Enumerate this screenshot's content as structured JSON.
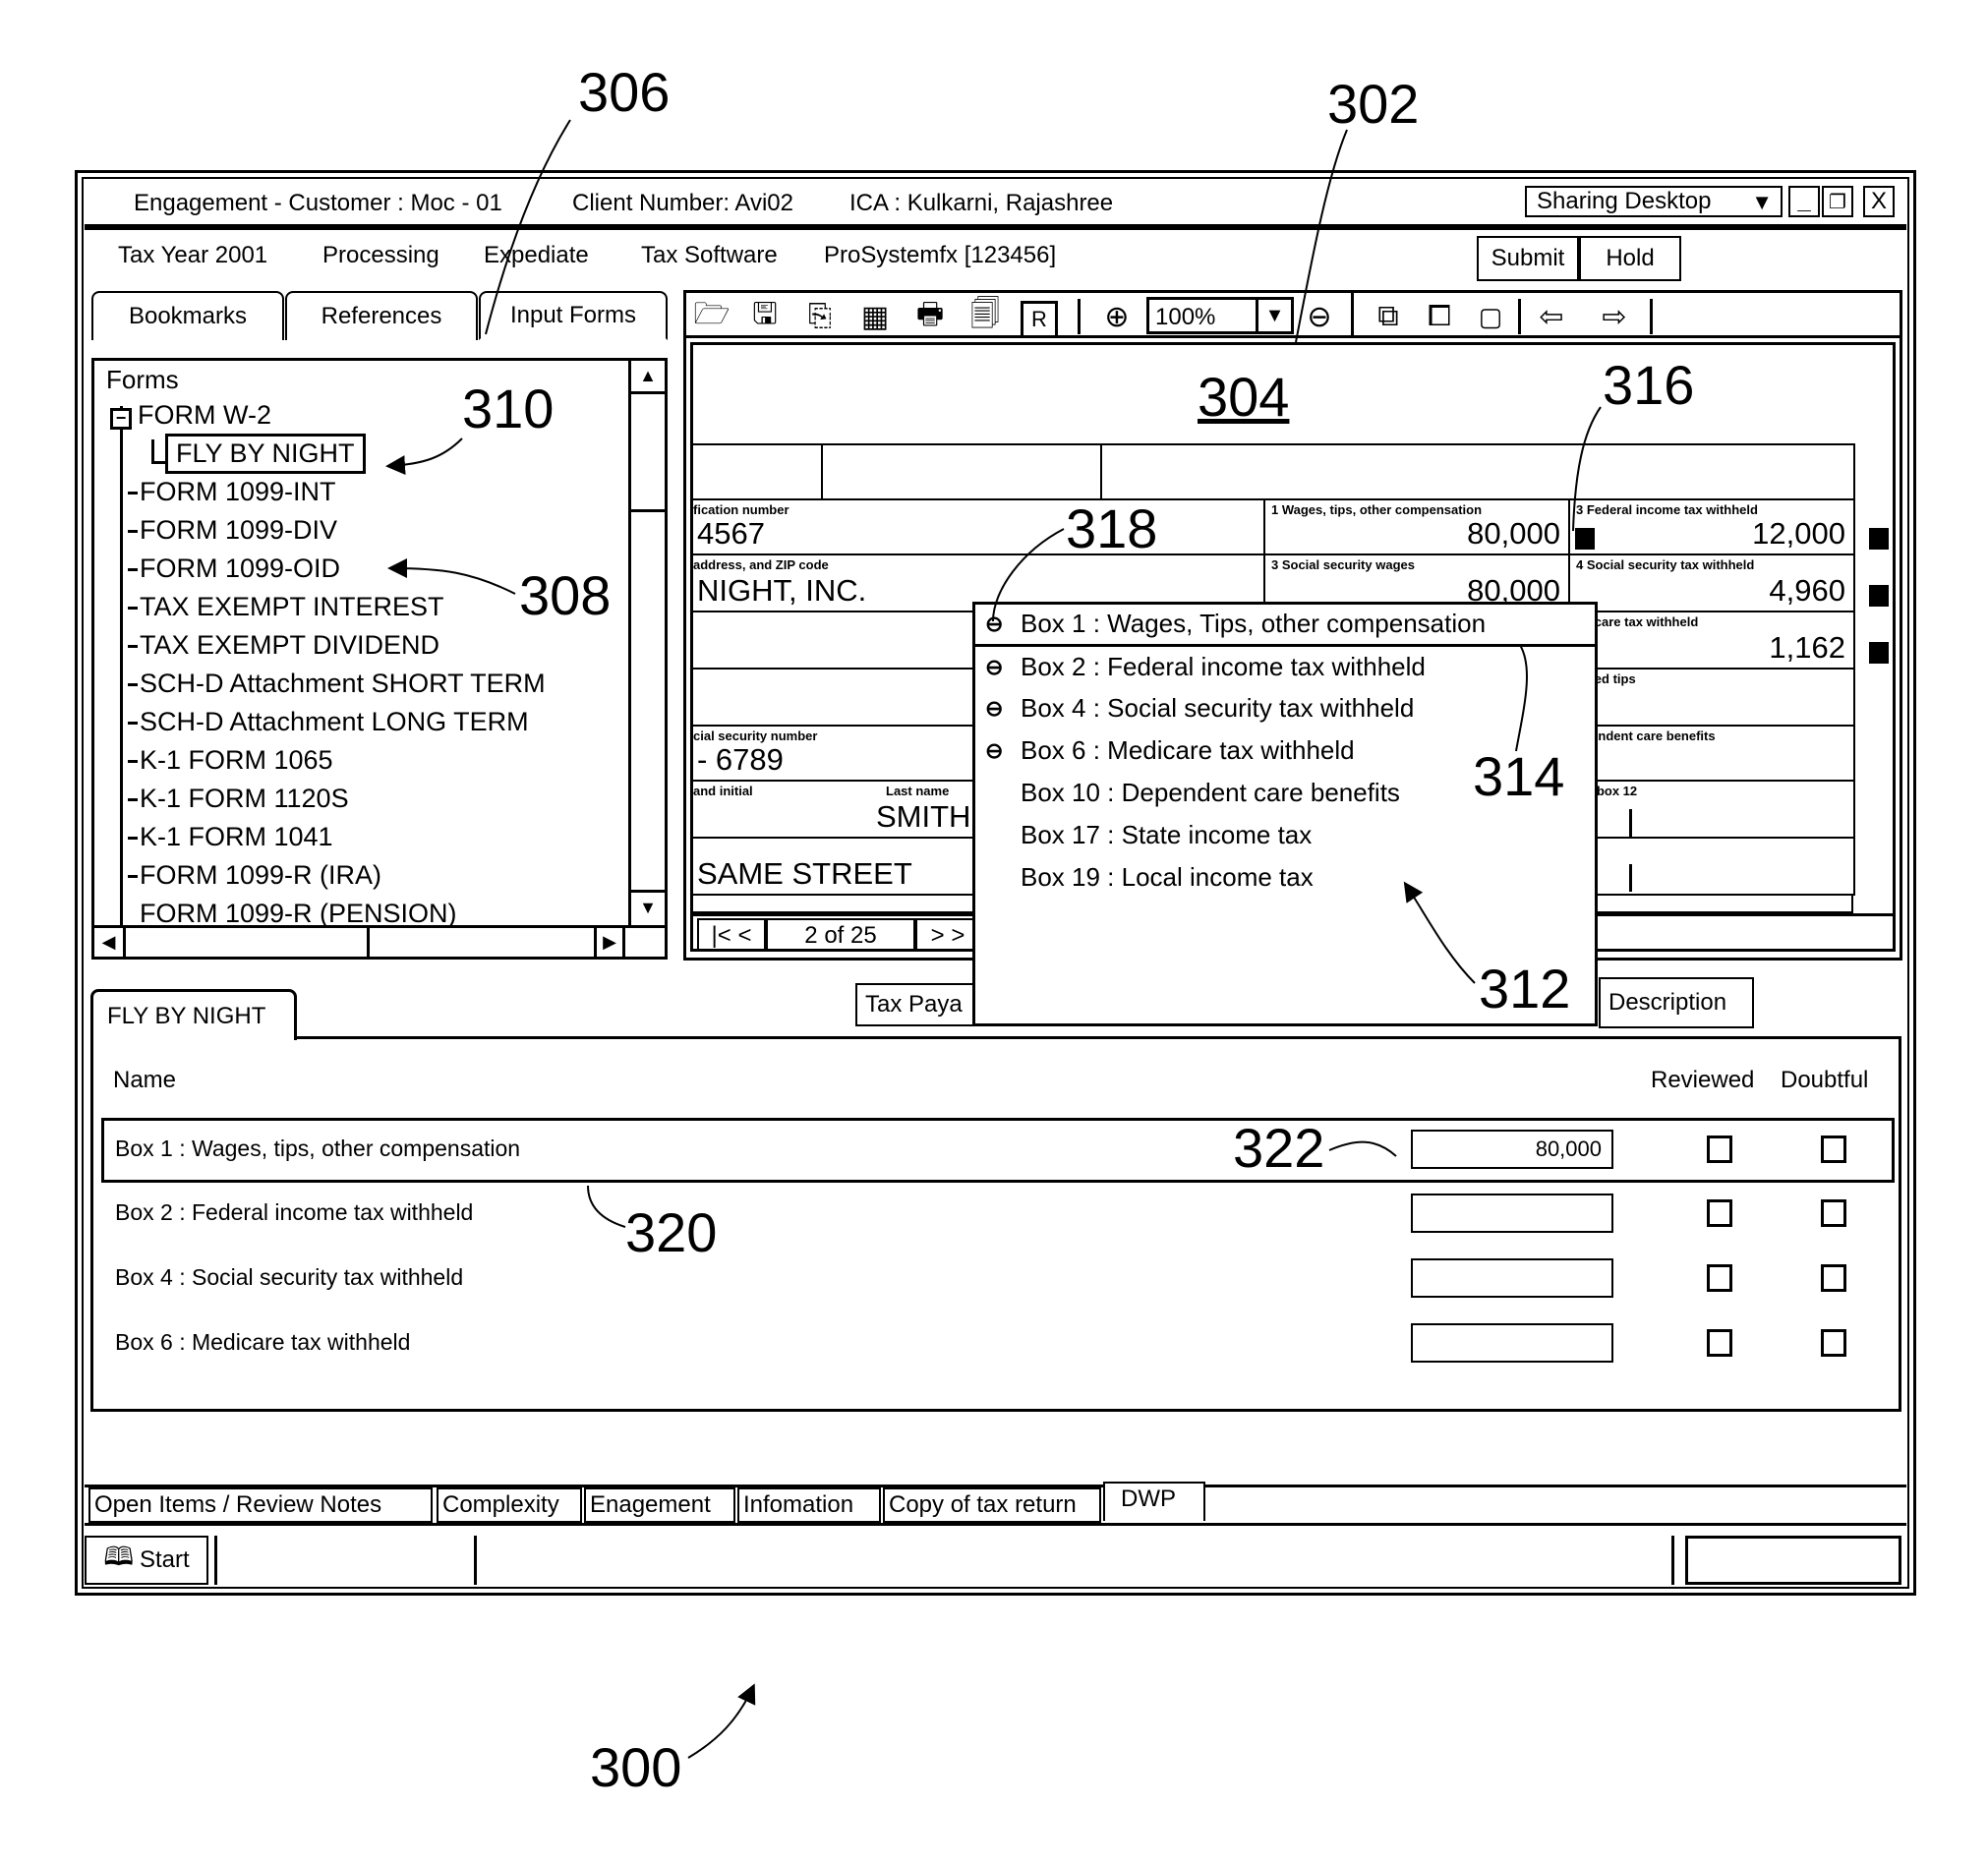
{
  "titlebar": {
    "engagement": "Engagement - Customer : Moc - 01",
    "client_number": "Client Number: Avi02",
    "ica": "ICA : Kulkarni, Rajashree",
    "sharing_select": "Sharing Desktop",
    "minimize_icon": "minimize-icon",
    "restore_icon": "restore-icon",
    "close_icon": "close-icon"
  },
  "menubar": {
    "tax_year": "Tax Year  2001",
    "processing": "Processing",
    "expedite": "Expediate",
    "tax_software": "Tax Software",
    "software_name": "ProSystemfx  [123456]",
    "submit": "Submit",
    "hold": "Hold"
  },
  "left_tabs": [
    "Bookmarks",
    "References",
    "Input Forms"
  ],
  "tree": {
    "root": "Forms",
    "parent": "FORM W-2",
    "selected_child": "FLY BY NIGHT",
    "items": [
      "FORM 1099-INT",
      "FORM 1099-DIV",
      "FORM 1099-OID",
      "TAX EXEMPT INTEREST",
      "TAX EXEMPT DIVIDEND",
      "SCH-D Attachment SHORT TERM",
      "SCH-D Attachment LONG TERM",
      "K-1 FORM 1065",
      "K-1 FORM 1120S",
      "K-1 FORM 1041",
      "FORM 1099-R (IRA)",
      "FORM 1099-R (PENSION)"
    ]
  },
  "toolbar": {
    "icons": [
      "open-folder-icon",
      "save-icon",
      "export-icon",
      "grid-icon",
      "print-icon",
      "document-icon",
      "report-icon"
    ],
    "zoom_in_icon": "zoom-in-icon",
    "zoom_level": "100%",
    "zoom_out_icon": "zoom-out-icon",
    "right_icons": [
      "copy-icon",
      "paste-icon",
      "page-icon",
      "previous-icon",
      "next-icon"
    ]
  },
  "form": {
    "ein_label": "fication number",
    "ein_value": "4567",
    "employer_label": "address, and ZIP code",
    "employer_value": "NIGHT, INC.",
    "ssn_label": "cial security number",
    "ssn_value": "- 6789",
    "first_name_label": "and initial",
    "last_name_label": "Last name",
    "last_name_value": "SMITH",
    "address_value": "SAME STREET",
    "boxes": [
      {
        "label": "1   Wages, tips, other compensation",
        "value": "80,000"
      },
      {
        "label": "3   Federal income tax withheld",
        "value": "12,000"
      },
      {
        "label": "3   Social security wages",
        "value": "80,000"
      },
      {
        "label": "4   Social security tax withheld",
        "value": "4,960"
      },
      {
        "label": "edicare tax withheld",
        "value": "1,162"
      },
      {
        "label": "cated tips",
        "value": ""
      },
      {
        "label": "ependent care benefits",
        "value": ""
      },
      {
        "label": "for box 12",
        "value": ""
      }
    ],
    "page_indicator": "2 of 25",
    "first_prev": "|< <",
    "next_last": "> >"
  },
  "popup": {
    "items": [
      {
        "label": "Box 1 : Wages, Tips, other compensation",
        "linked": true
      },
      {
        "label": "Box 2 : Federal income tax withheld",
        "linked": true
      },
      {
        "label": "Box 4 : Social security tax withheld",
        "linked": true
      },
      {
        "label": "Box 6 : Medicare tax withheld",
        "linked": true
      },
      {
        "label": "Box 10 : Dependent care benefits",
        "linked": false
      },
      {
        "label": "Box 17 : State income tax",
        "linked": false
      },
      {
        "label": "Box 19 : Local income tax",
        "linked": false
      }
    ],
    "link_glyph": "⊖"
  },
  "lower_buttons": {
    "tax_payable": "Tax Paya",
    "description": "Description"
  },
  "detail": {
    "tab": "FLY BY NIGHT",
    "col_name": "Name",
    "col_reviewed": "Reviewed",
    "col_doubtful": "Doubtful",
    "rows": [
      {
        "name": "Box 1 : Wages, tips, other compensation",
        "amount": "80,000",
        "reviewed": false,
        "doubtful": false
      },
      {
        "name": "Box 2 : Federal income tax withheld",
        "amount": "",
        "reviewed": false,
        "doubtful": false
      },
      {
        "name": "Box 4 : Social security tax withheld",
        "amount": "",
        "reviewed": false,
        "doubtful": false
      },
      {
        "name": "Box 6 : Medicare tax withheld",
        "amount": "",
        "reviewed": false,
        "doubtful": false
      }
    ]
  },
  "bottom_tabs": [
    "Open Items / Review Notes",
    "Complexity",
    "Enagement",
    "Infomation",
    "Copy of tax return",
    "DWP"
  ],
  "statusbar": {
    "start": "Start"
  },
  "reference_numerals": {
    "r300": "300",
    "r302": "302",
    "r304": "304",
    "r306": "306",
    "r308": "308",
    "r310": "310",
    "r312": "312",
    "r314": "314",
    "r316": "316",
    "r318": "318",
    "r320": "320",
    "r322": "322"
  }
}
